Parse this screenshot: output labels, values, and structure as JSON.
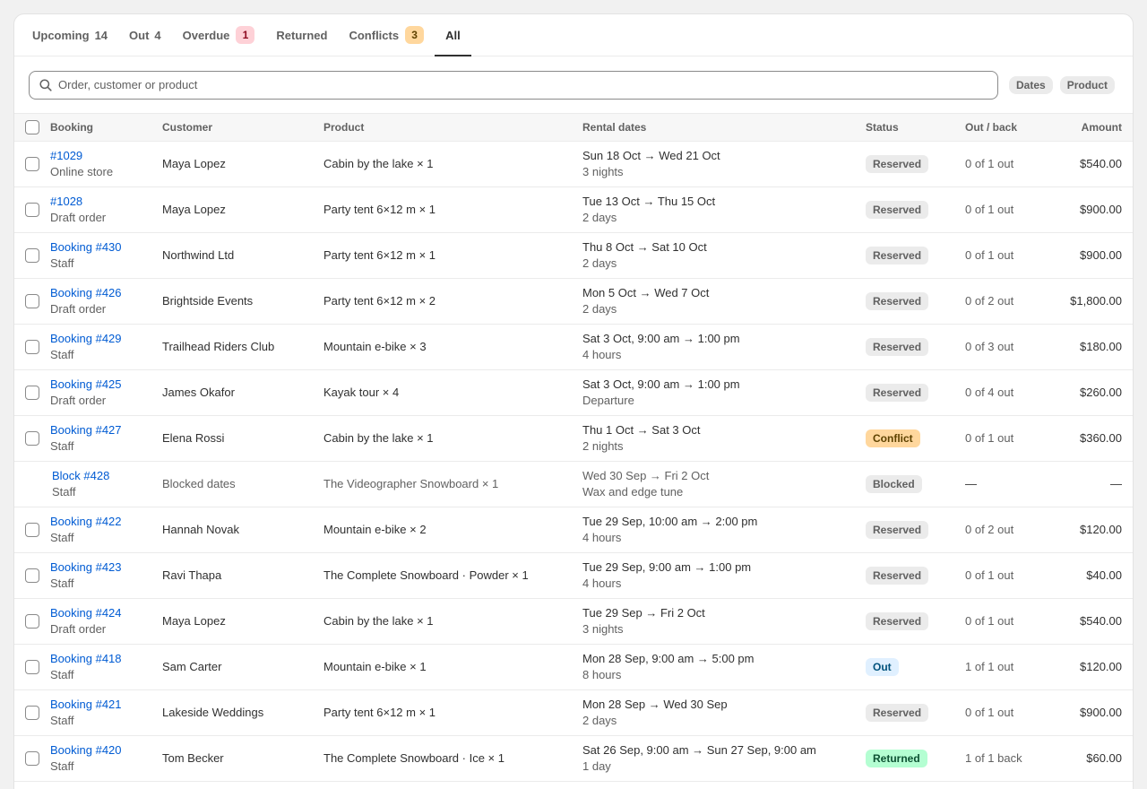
{
  "tabs": [
    {
      "label": "Upcoming",
      "count": "14",
      "badge": null,
      "active": false
    },
    {
      "label": "Out",
      "count": "4",
      "badge": null,
      "active": false
    },
    {
      "label": "Overdue",
      "count": "",
      "badge": {
        "text": "1",
        "tone": "critical"
      },
      "active": false
    },
    {
      "label": "Returned",
      "count": "",
      "badge": null,
      "active": false
    },
    {
      "label": "Conflicts",
      "count": "",
      "badge": {
        "text": "3",
        "tone": "warning"
      },
      "active": false
    },
    {
      "label": "All",
      "count": "",
      "badge": null,
      "active": true
    }
  ],
  "search": {
    "placeholder": "Order, customer or product",
    "value": "",
    "icon": "search-icon"
  },
  "filters": [
    "Dates",
    "Product"
  ],
  "columns": {
    "booking": "Booking",
    "customer": "Customer",
    "product": "Product",
    "dates": "Rental dates",
    "status": "Status",
    "outback": "Out / back",
    "amount": "Amount"
  },
  "rows": [
    {
      "booking": "#1029",
      "source": "Online store",
      "customer": "Maya Lopez",
      "product": "Cabin by the lake × 1",
      "dates": "Sun 18 Oct → Wed 21 Oct",
      "duration": "3 nights",
      "status": "Reserved",
      "status_tone": "reserved",
      "outback": "0 of 1 out",
      "amount": "$540.00",
      "selectable": true
    },
    {
      "booking": "#1028",
      "source": "Draft order",
      "customer": "Maya Lopez",
      "product": "Party tent 6×12 m × 1",
      "dates": "Tue 13 Oct → Thu 15 Oct",
      "duration": "2 days",
      "status": "Reserved",
      "status_tone": "reserved",
      "outback": "0 of 1 out",
      "amount": "$900.00",
      "selectable": true
    },
    {
      "booking": "Booking #430",
      "source": "Staff",
      "customer": "Northwind Ltd",
      "product": "Party tent 6×12 m × 1",
      "dates": "Thu 8 Oct → Sat 10 Oct",
      "duration": "2 days",
      "status": "Reserved",
      "status_tone": "reserved",
      "outback": "0 of 1 out",
      "amount": "$900.00",
      "selectable": true
    },
    {
      "booking": "Booking #426",
      "source": "Draft order",
      "customer": "Brightside Events",
      "product": "Party tent 6×12 m × 2",
      "dates": "Mon 5 Oct → Wed 7 Oct",
      "duration": "2 days",
      "status": "Reserved",
      "status_tone": "reserved",
      "outback": "0 of 2 out",
      "amount": "$1,800.00",
      "selectable": true
    },
    {
      "booking": "Booking #429",
      "source": "Staff",
      "customer": "Trailhead Riders Club",
      "product": "Mountain e-bike × 3",
      "dates": "Sat 3 Oct, 9:00 am → 1:00 pm",
      "duration": "4 hours",
      "status": "Reserved",
      "status_tone": "reserved",
      "outback": "0 of 3 out",
      "amount": "$180.00",
      "selectable": true
    },
    {
      "booking": "Booking #425",
      "source": "Draft order",
      "customer": "James Okafor",
      "product": "Kayak tour × 4",
      "dates": "Sat 3 Oct, 9:00 am → 1:00 pm",
      "duration": "Departure",
      "status": "Reserved",
      "status_tone": "reserved",
      "outback": "0 of 4 out",
      "amount": "$260.00",
      "selectable": true
    },
    {
      "booking": "Booking #427",
      "source": "Staff",
      "customer": "Elena Rossi",
      "product": "Cabin by the lake × 1",
      "dates": "Thu 1 Oct → Sat 3 Oct",
      "duration": "2 nights",
      "status": "Conflict",
      "status_tone": "conflict",
      "outback": "0 of 1 out",
      "amount": "$360.00",
      "selectable": true
    },
    {
      "booking": "Block #428",
      "source": "Staff",
      "customer": "Blocked dates",
      "product": "The Videographer Snowboard × 1",
      "dates": "Wed 30 Sep → Fri 2 Oct",
      "duration": "Wax and edge tune",
      "status": "Blocked",
      "status_tone": "blocked",
      "outback": "—",
      "amount": "—",
      "selectable": false
    },
    {
      "booking": "Booking #422",
      "source": "Staff",
      "customer": "Hannah Novak",
      "product": "Mountain e-bike × 2",
      "dates": "Tue 29 Sep, 10:00 am → 2:00 pm",
      "duration": "4 hours",
      "status": "Reserved",
      "status_tone": "reserved",
      "outback": "0 of 2 out",
      "amount": "$120.00",
      "selectable": true
    },
    {
      "booking": "Booking #423",
      "source": "Staff",
      "customer": "Ravi Thapa",
      "product": "The Complete Snowboard · Powder × 1",
      "dates": "Tue 29 Sep, 9:00 am → 1:00 pm",
      "duration": "4 hours",
      "status": "Reserved",
      "status_tone": "reserved",
      "outback": "0 of 1 out",
      "amount": "$40.00",
      "selectable": true
    },
    {
      "booking": "Booking #424",
      "source": "Draft order",
      "customer": "Maya Lopez",
      "product": "Cabin by the lake × 1",
      "dates": "Tue 29 Sep → Fri 2 Oct",
      "duration": "3 nights",
      "status": "Reserved",
      "status_tone": "reserved",
      "outback": "0 of 1 out",
      "amount": "$540.00",
      "selectable": true
    },
    {
      "booking": "Booking #418",
      "source": "Staff",
      "customer": "Sam Carter",
      "product": "Mountain e-bike × 1",
      "dates": "Mon 28 Sep, 9:00 am → 5:00 pm",
      "duration": "8 hours",
      "status": "Out",
      "status_tone": "out",
      "outback": "1 of 1 out",
      "amount": "$120.00",
      "selectable": true
    },
    {
      "booking": "Booking #421",
      "source": "Staff",
      "customer": "Lakeside Weddings",
      "product": "Party tent 6×12 m × 1",
      "dates": "Mon 28 Sep → Wed 30 Sep",
      "duration": "2 days",
      "status": "Reserved",
      "status_tone": "reserved",
      "outback": "0 of 1 out",
      "amount": "$900.00",
      "selectable": true
    },
    {
      "booking": "Booking #420",
      "source": "Staff",
      "customer": "Tom Becker",
      "product": "The Complete Snowboard · Ice × 1",
      "dates": "Sat 26 Sep, 9:00 am → Sun 27 Sep, 9:00 am",
      "duration": "1 day",
      "status": "Returned",
      "status_tone": "returned",
      "outback": "1 of 1 back",
      "amount": "$60.00",
      "selectable": true
    }
  ]
}
